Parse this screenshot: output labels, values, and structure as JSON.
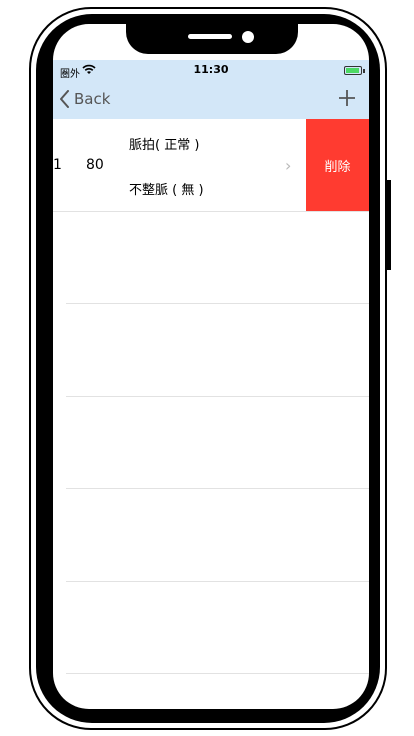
{
  "status": {
    "carrier": "圏外",
    "time": "11:30"
  },
  "nav": {
    "back_label": "Back",
    "add_icon": "plus-icon"
  },
  "row": {
    "value1": "1",
    "value2": "80",
    "pulse": "脈拍( 正常 )",
    "arrhythmia": "不整脈 ( 無 )",
    "delete_label": "削除"
  },
  "colors": {
    "navbar": "#d3e7f8",
    "delete": "#ff3b30"
  }
}
